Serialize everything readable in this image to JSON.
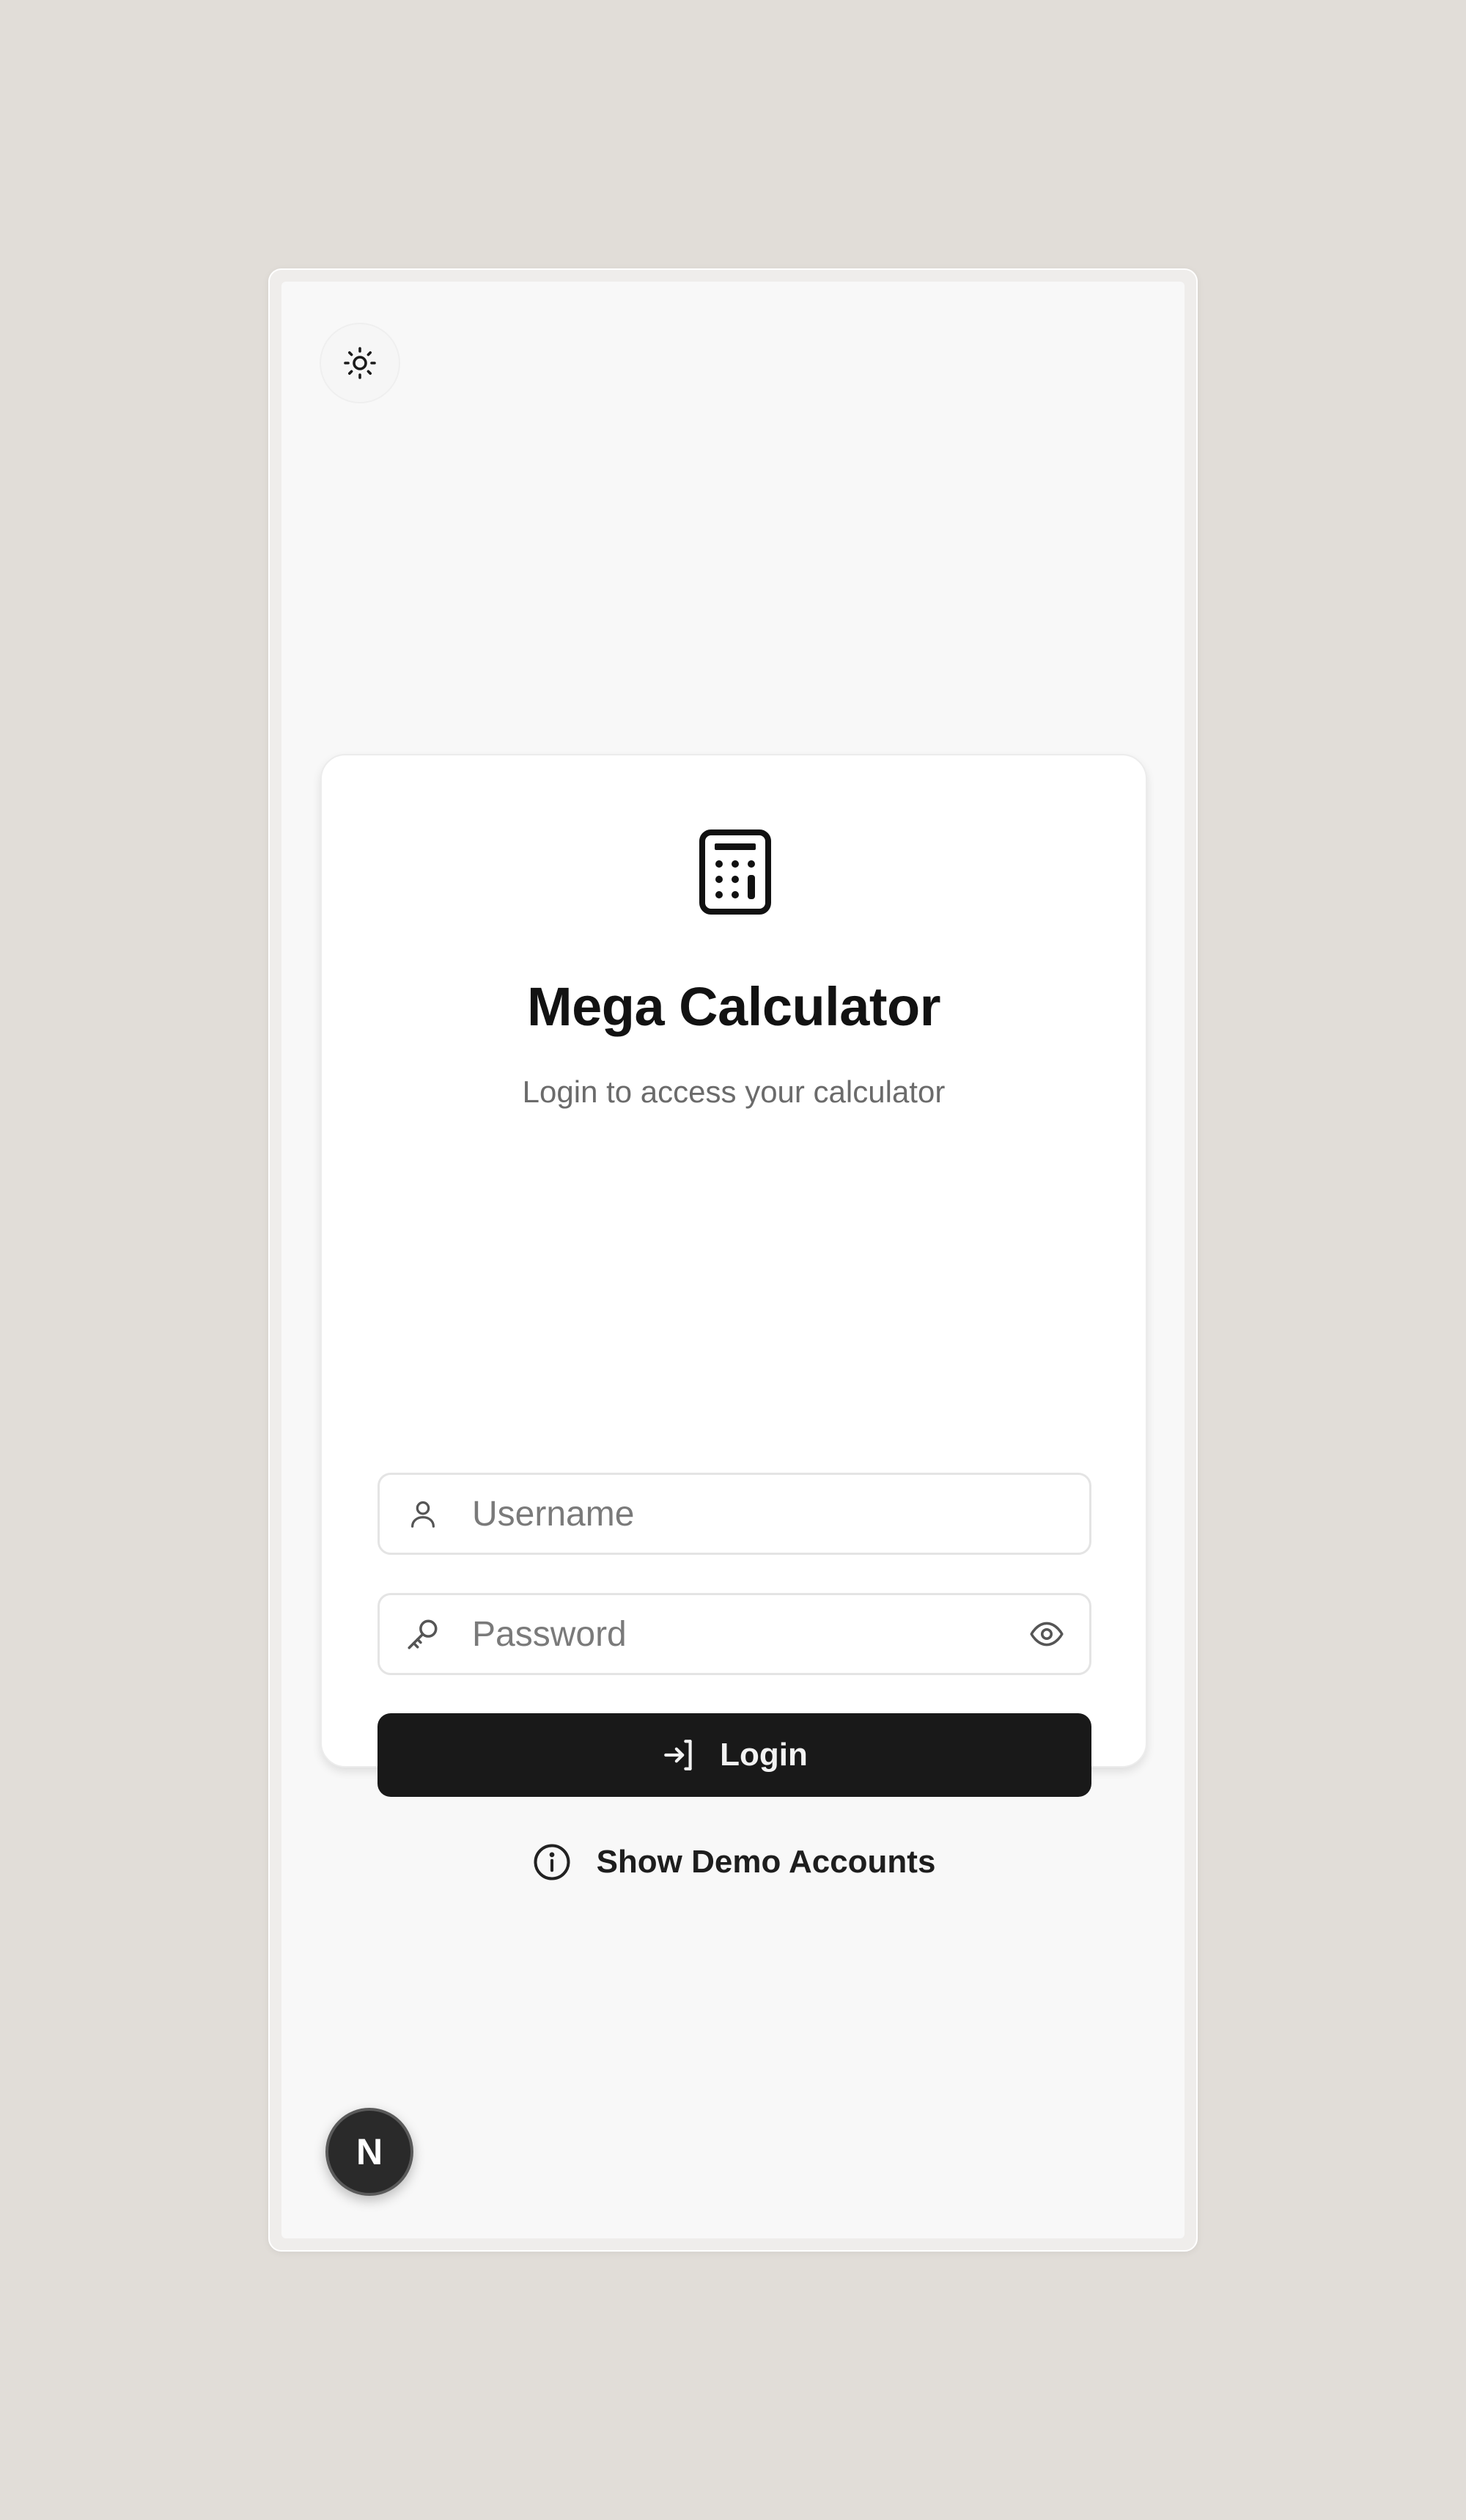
{
  "header": {
    "theme_toggle_icon": "sun-icon"
  },
  "login_card": {
    "app_icon": "calculator-icon",
    "title": "Mega Calculator",
    "subtitle": "Login to access your calculator",
    "username": {
      "icon": "user-icon",
      "placeholder": "Username",
      "value": ""
    },
    "password": {
      "icon": "key-icon",
      "placeholder": "Password",
      "value": "",
      "toggle_icon": "eye-icon"
    },
    "login_button": {
      "icon": "log-in-icon",
      "label": "Login"
    },
    "demo_link": {
      "icon": "info-icon",
      "label": "Show Demo Accounts"
    }
  },
  "footer": {
    "badge_letter": "N"
  },
  "colors": {
    "background": "#e1ddd8",
    "screen": "#f8f8f8",
    "card": "#ffffff",
    "primary_button": "#191919",
    "text_primary": "#121212",
    "text_muted": "#6b6b6b"
  }
}
